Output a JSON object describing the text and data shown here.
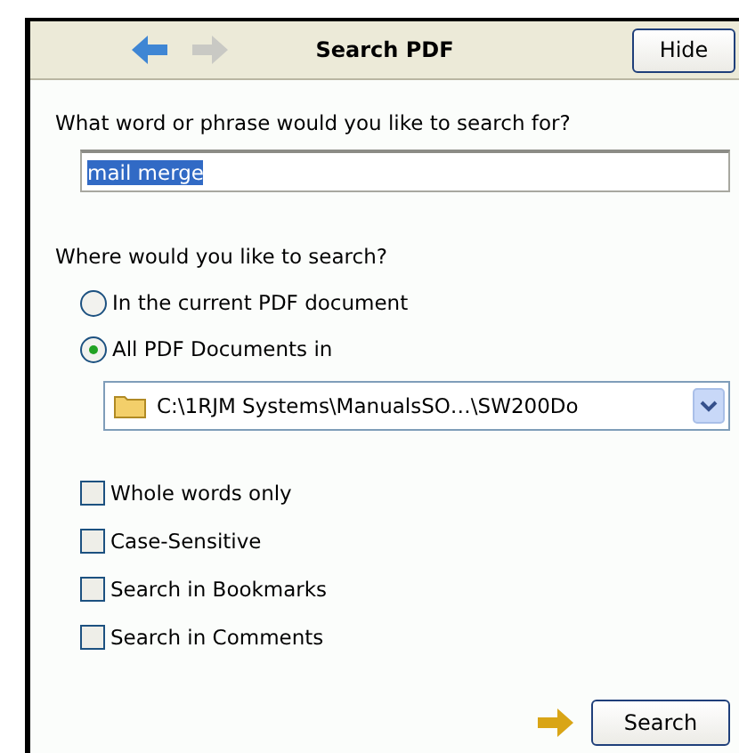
{
  "header": {
    "title": "Search PDF",
    "back_enabled": true,
    "forward_enabled": false,
    "hide_button": "Hide"
  },
  "query": {
    "prompt": "What word or phrase would you like to search for?",
    "value": "mail merge",
    "text_selected": true
  },
  "scope": {
    "prompt": "Where would you like to search?",
    "options": [
      {
        "label": "In the current PDF document",
        "selected": false
      },
      {
        "label": "All PDF Documents in",
        "selected": true
      }
    ],
    "folder": "C:\\1RJM Systems\\ManualsSO…\\SW200Do"
  },
  "options": [
    {
      "label": "Whole words only",
      "checked": false
    },
    {
      "label": "Case-Sensitive",
      "checked": false
    },
    {
      "label": "Search in Bookmarks",
      "checked": false
    },
    {
      "label": "Search in Comments",
      "checked": false
    }
  ],
  "search_button": "Search"
}
